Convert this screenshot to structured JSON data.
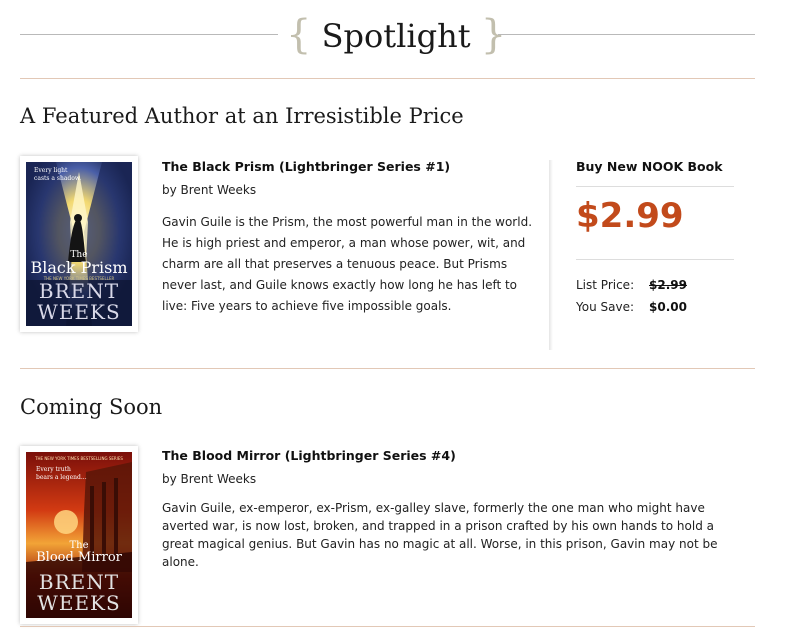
{
  "header": {
    "open_brace": "{",
    "title": "Spotlight",
    "close_brace": "}"
  },
  "featured": {
    "section_title": "A Featured Author at an Irresistible Price",
    "book": {
      "title": "The Black Prism (Lightbringer Series #1)",
      "author": "by Brent Weeks",
      "description": "Gavin Guile is the Prism, the most powerful man in the world. He is high priest and emperor, a man whose power, wit, and charm are all that preserves a tenuous peace. But Prisms never last, and Guile knows exactly how long he has left to live: Five years to achieve five impossible goals.",
      "cover": {
        "tagline_1": "Every light",
        "tagline_2": "casts a shadow.",
        "title_line_1": "The",
        "title_line_2": "Black Prism",
        "banner": "THE NEW YORK TIMES BESTSELLER",
        "author_1": "BRENT",
        "author_2": "WEEKS"
      }
    },
    "purchase": {
      "label": "Buy New NOOK Book",
      "price": "$2.99",
      "list_price_label": "List Price:",
      "list_price_value": "$2.99",
      "you_save_label": "You Save:",
      "you_save_value": "$0.00",
      "price_color": "#c24a1b"
    }
  },
  "coming_soon": {
    "section_title": "Coming Soon",
    "book": {
      "title": "The Blood Mirror (Lightbringer Series #4)",
      "author": "by Brent Weeks",
      "description": "Gavin Guile, ex-emperor, ex-Prism, ex-galley slave, formerly the one man who might have averted war, is now lost, broken, and trapped in a prison crafted by his own hands to hold a great magical genius. But Gavin has no magic at all. Worse, in this prison, Gavin may not be alone.",
      "cover": {
        "banner": "THE NEW YORK TIMES BESTSELLING SERIES",
        "tagline_1": "Every truth",
        "tagline_2": "bears a legend...",
        "title_line_1": "The",
        "title_line_2": "Blood Mirror",
        "author_1": "BRENT",
        "author_2": "WEEKS"
      }
    }
  }
}
